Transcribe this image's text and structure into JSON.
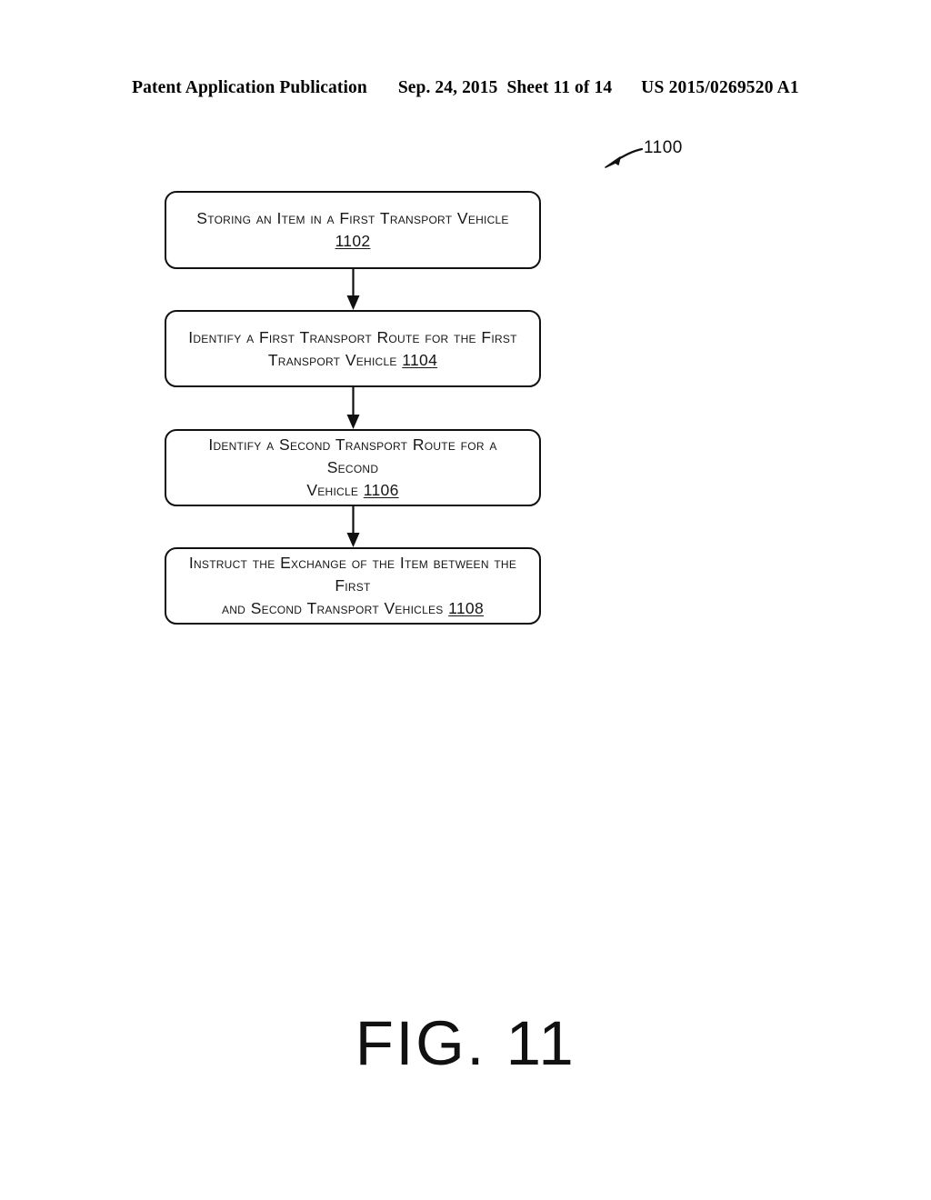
{
  "header": {
    "publication": "Patent Application Publication",
    "date": "Sep. 24, 2015",
    "sheet": "Sheet 11 of 14",
    "patent_number": "US 2015/0269520 A1"
  },
  "figure": {
    "caption": "FIG. 11",
    "diagram_reference": "1100",
    "boxes": [
      {
        "id": "1102",
        "text": "Storing an Item in a First Transport Vehicle",
        "ref": "1102",
        "lines": [
          "Storing an Item in a First Transport Vehicle 1102"
        ]
      },
      {
        "id": "1104",
        "text": "Identify a First Transport Route for the First Transport Vehicle",
        "ref": "1104",
        "lines": [
          "Identify a First Transport Route for the First",
          "Transport Vehicle 1104"
        ]
      },
      {
        "id": "1106",
        "text": "Identify a Second Transport Route for a Second Vehicle",
        "ref": "1106",
        "lines": [
          "Identify a Second Transport Route for a Second",
          "Vehicle 1106"
        ]
      },
      {
        "id": "1108",
        "text": "Instruct the Exchange of the Item between the First and Second Transport Vehicles",
        "ref": "1108",
        "lines": [
          "Instruct the Exchange of the Item between the First",
          "and Second Transport Vehicles 1108"
        ]
      }
    ],
    "box_text_parts": {
      "b1_l1": "Storing an Item in a First Transport Vehicle ",
      "b1_ref": "1102",
      "b2_l1": "Identify a First Transport Route for the First",
      "b2_l2": "Transport Vehicle ",
      "b2_ref": "1104",
      "b3_l1": "Identify a Second Transport Route for a Second",
      "b3_l2": "Vehicle ",
      "b3_ref": "1106",
      "b4_l1": "Instruct the Exchange of the Item between the First",
      "b4_l2": "and Second Transport Vehicles ",
      "b4_ref": "1108"
    }
  },
  "colors": {
    "ink": "#111111",
    "paper": "#ffffff"
  }
}
